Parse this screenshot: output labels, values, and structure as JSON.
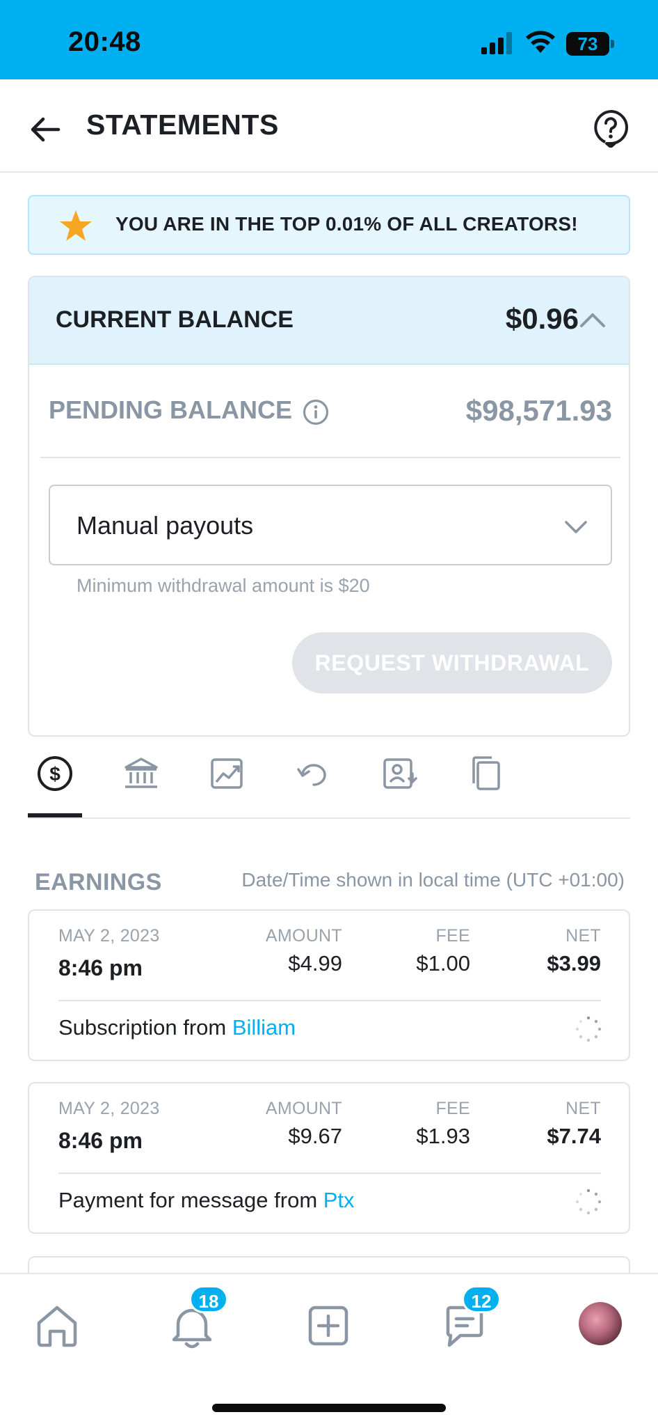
{
  "status_bar": {
    "time": "20:48",
    "battery": "73",
    "battery_level": 0.73
  },
  "header": {
    "title": "STATEMENTS",
    "back_icon": "arrow-left-icon",
    "help_icon": "question-bubble-icon"
  },
  "banner": {
    "text": "YOU ARE IN THE TOP 0.01% OF ALL CREATORS!",
    "icon": "star-icon",
    "accent": "#f6a623"
  },
  "balance": {
    "current_label": "CURRENT BALANCE",
    "current_value": "$0.96",
    "pending_label": "PENDING BALANCE",
    "pending_value": "$98,571.93",
    "payout_option": "Manual payouts",
    "min_note": "Minimum withdrawal amount is $20",
    "withdraw_label": "REQUEST WITHDRAWAL"
  },
  "tabs": [
    {
      "icon": "dollar-circle-icon",
      "active": true
    },
    {
      "icon": "bank-icon",
      "active": false
    },
    {
      "icon": "chart-up-icon",
      "active": false
    },
    {
      "icon": "undo-icon",
      "active": false
    },
    {
      "icon": "contact-download-icon",
      "active": false
    },
    {
      "icon": "copy-icon",
      "active": false
    }
  ],
  "earnings": {
    "title": "EARNINGS",
    "note": "Date/Time shown in local time (UTC +01:00)",
    "columns": {
      "amount": "AMOUNT",
      "fee": "FEE",
      "net": "NET"
    },
    "rows": [
      {
        "date": "MAY 2, 2023",
        "time": "8:46 pm",
        "amount": "$4.99",
        "fee": "$1.00",
        "net": "$3.99",
        "desc_prefix": "Subscription from ",
        "user": "Billiam"
      },
      {
        "date": "MAY 2, 2023",
        "time": "8:46 pm",
        "amount": "$9.67",
        "fee": "$1.93",
        "net": "$7.74",
        "desc_prefix": "Payment for message from ",
        "user": "Ptx"
      }
    ]
  },
  "bottom_nav": {
    "notifications_badge": "18",
    "messages_badge": "12"
  },
  "colors": {
    "brand": "#00aff0",
    "muted": "#8a96a3"
  }
}
